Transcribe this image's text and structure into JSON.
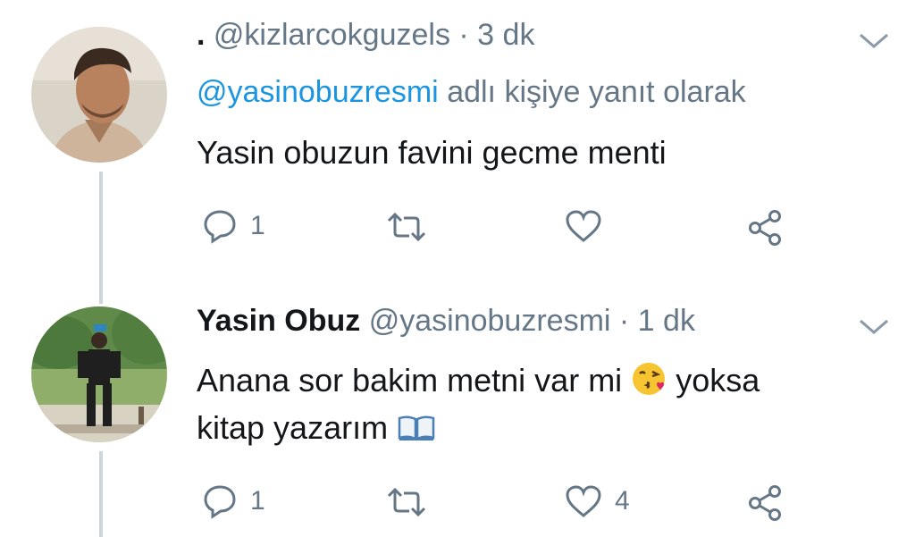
{
  "tweets": [
    {
      "display_name": "",
      "handle_prefix": ".",
      "handle": "@kizlarcokguzels",
      "time": "· 3 dk",
      "reply_to_handle": "@yasinobuzresmi",
      "reply_to_suffix": "adlı kişiye yanıt olarak",
      "text_line1": "Yasin obuzun favini gecme menti",
      "text_line2": "",
      "reply_count": "1",
      "retweet_count": "",
      "like_count": ""
    },
    {
      "display_name": "Yasin Obuz",
      "handle": "@yasinobuzresmi",
      "time": "· 1 dk",
      "text_line1_a": "Anana sor bakim metni var mi",
      "text_line1_b": "yoksa",
      "text_line2": "kitap yazarım",
      "reply_count": "1",
      "retweet_count": "",
      "like_count": "4"
    }
  ],
  "icons": {
    "reply": "reply-icon",
    "retweet": "retweet-icon",
    "like": "heart-icon",
    "share": "share-icon",
    "caret": "chevron-down-icon",
    "emoji1": "kissing-face-emoji",
    "emoji2": "open-book-emoji"
  },
  "colors": {
    "link": "#1b95e0",
    "muted": "#657786",
    "thread_line": "#cdd6dd"
  }
}
